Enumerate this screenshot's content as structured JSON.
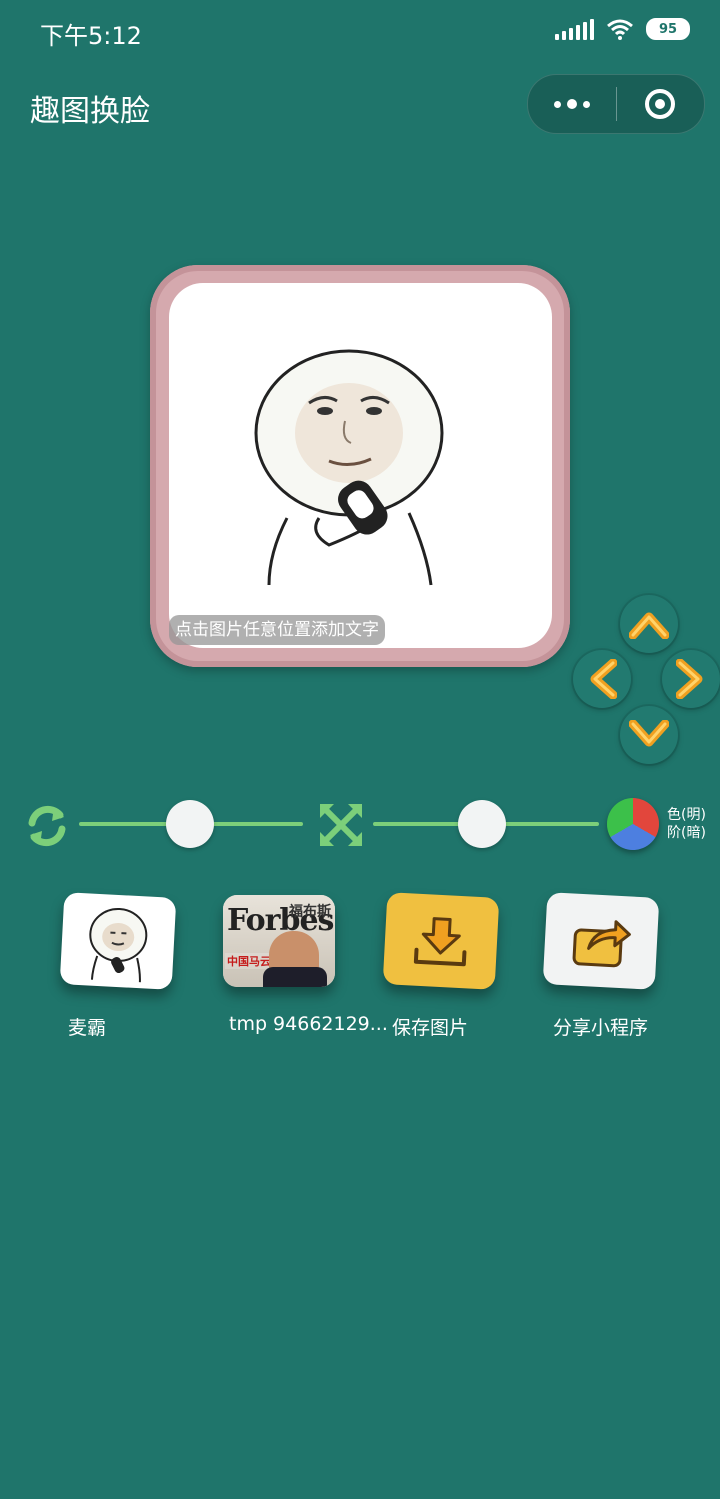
{
  "status_bar": {
    "time": "下午5:12",
    "battery": "95"
  },
  "header": {
    "title": "趣图换脸"
  },
  "canvas": {
    "hint": "点击图片任意位置添加文字"
  },
  "controls": {
    "color_label_top": "色(明)",
    "color_label_bottom": "阶(暗)"
  },
  "tiles": [
    {
      "label": "麦霸"
    },
    {
      "label": "tmp 94662129...",
      "magazine_brand": "Forbes",
      "magazine_cn": "福布斯",
      "magazine_headline": "中国马云"
    },
    {
      "label": "保存图片"
    },
    {
      "label": "分享小程序"
    }
  ],
  "colors": {
    "background": "#1f756b",
    "frame": "#d5a9ae",
    "save_tile": "#f0c040",
    "share_tile": "#f2f3f3",
    "accent_orange": "#f0a020"
  }
}
